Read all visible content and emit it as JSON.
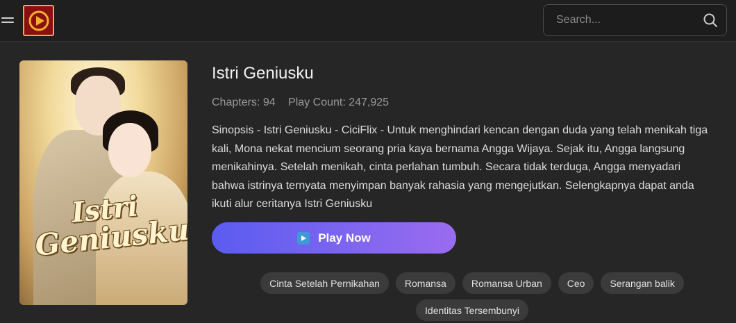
{
  "header": {
    "search_placeholder": "Search..."
  },
  "cover": {
    "title_line1": "Istri",
    "title_line2": "Geniusku"
  },
  "book": {
    "title": "Istri Geniusku",
    "chapters": "Chapters: 94",
    "play_count": "Play Count: 247,925",
    "synopsis": "Sinopsis - Istri Geniusku - CiciFlix - Untuk menghindari kencan dengan duda yang telah menikah tiga kali, Mona nekat mencium seorang pria kaya bernama Angga Wijaya. Sejak itu, Angga langsung menikahinya. Setelah menikah, cinta perlahan tumbuh. Secara tidak terduga, Angga menyadari bahwa istrinya ternyata menyimpan banyak rahasia yang mengejutkan. Selengkapnya dapat anda ikuti alur ceritanya Istri Geniusku",
    "play_label": "Play Now"
  },
  "tags": [
    "Cinta Setelah Pernikahan",
    "Romansa",
    "Romansa Urban",
    "Ceo",
    "Serangan balik",
    "Identitas Tersembunyi"
  ],
  "icons": {
    "menu": "menu-icon",
    "logo": "play-logo-icon",
    "search": "search-icon",
    "play": "play-icon"
  },
  "colors": {
    "background": "#262626",
    "header": "#1f1f1f",
    "play_gradient_start": "#5a5cf0",
    "play_gradient_end": "#9a6cf0",
    "tag_bg": "#3b3b3b",
    "logo_red": "#8a0f12",
    "logo_gold": "#f0b02a"
  }
}
